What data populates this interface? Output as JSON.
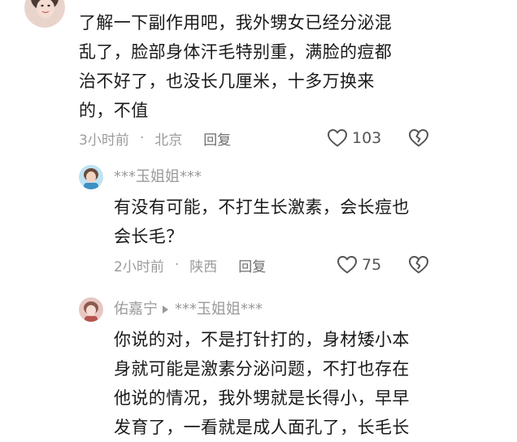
{
  "comments": [
    {
      "lines": [
        "了解一下副作用吧，我外甥女已经分泌混",
        "乱了，脸部身体汗毛特别重，满脸的痘都",
        "治不好了，也没长几厘米，十多万换来",
        "的，不值"
      ],
      "time": "3小时前",
      "location": "北京",
      "reply_label": "回复",
      "likes": "103"
    },
    {
      "username": "***玉姐姐***",
      "lines": [
        "有没有可能，不打生长激素，会长痘也",
        "会长毛？"
      ],
      "time": "2小时前",
      "location": "陕西",
      "reply_label": "回复",
      "likes": "75"
    },
    {
      "username": "佑嘉宁",
      "reply_to": "***玉姐姐***",
      "lines": [
        "你说的对，不是打针打的，身材矮小本",
        "身就可能是激素分泌问题，不打也存在",
        "他说的情况，我外甥就是长得小，早早",
        "发育了，一看就是成人面孔了，长毛长"
      ]
    }
  ],
  "separator": "·",
  "icons": [
    "avatar",
    "heart-icon",
    "broken-heart-icon",
    "reply-arrow-icon"
  ]
}
